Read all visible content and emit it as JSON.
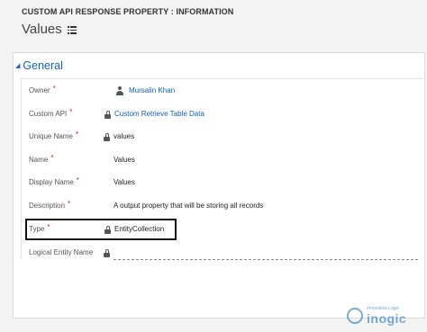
{
  "header": {
    "entity_type": "CUSTOM API RESPONSE PROPERTY : INFORMATION",
    "record_title": "Values"
  },
  "section": {
    "title": "General",
    "fields": [
      {
        "label": "Owner",
        "required": "*",
        "value": "Mursalin Khan",
        "icon": "user-icon",
        "is_link": true
      },
      {
        "label": "Custom API",
        "required": "*",
        "value": "Custom Retrieve Table Data",
        "icon": "lock-icon",
        "is_link": true
      },
      {
        "label": "Unique Name",
        "required": "*",
        "value": "values",
        "icon": "lock-icon",
        "is_link": false
      },
      {
        "label": "Name",
        "required": "*",
        "value": "Values",
        "icon": "",
        "is_link": false
      },
      {
        "label": "Display Name",
        "required": "*",
        "value": "Values",
        "icon": "",
        "is_link": false
      },
      {
        "label": "Description",
        "required": "*",
        "value": "A output property that will be storing all records",
        "icon": "",
        "is_link": false
      },
      {
        "label": "Type",
        "required": "*",
        "value": "EntityCollection",
        "icon": "lock-icon",
        "is_link": false
      },
      {
        "label": "Logical Entity Name",
        "required": "",
        "value": "",
        "icon": "lock-icon",
        "is_link": false
      }
    ]
  },
  "watermark": {
    "tagline": "Innovative Logic",
    "brand": "inogic"
  },
  "colors": {
    "link": "#1160b7",
    "required": "#d11c1c",
    "header_bg": "#f3f3f3"
  }
}
